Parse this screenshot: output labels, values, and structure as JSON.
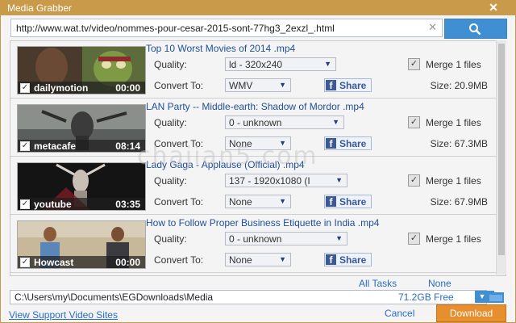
{
  "window": {
    "title": "Media Grabber"
  },
  "url_bar": {
    "value": "http://www.wat.tv/video/nommes-pour-cesar-2015-sont-77hg3_2exzl_.html"
  },
  "labels": {
    "quality": "Quality:",
    "convert_to": "Convert To:",
    "share": "Share",
    "merge": "Merge 1 files"
  },
  "items": [
    {
      "title": "Top 10 Worst Movies of 2014 .mp4",
      "source": "dailymotion",
      "duration": "00:00",
      "quality": "ld - 320x240",
      "convert": "WMV",
      "size": "Size: 20.9MB"
    },
    {
      "title": "LAN Party -- Middle-earth: Shadow of Mordor .mp4",
      "source": "metacafe",
      "duration": "08:14",
      "quality": "0 - unknown",
      "convert": "None",
      "size": "Size: 67.3MB"
    },
    {
      "title": "Lady Gaga - Applause (Official) .mp4",
      "source": "youtube",
      "duration": "03:35",
      "quality": "137 - 1920x1080 (I",
      "convert": "None",
      "size": "Size: 67.9MB"
    },
    {
      "title": "How to Follow Proper Business Etiquette in India .mp4",
      "source": "Howcast",
      "duration": "00:00",
      "quality": "0 - unknown",
      "convert": "None",
      "size": ""
    }
  ],
  "footer": {
    "all_tasks": "All Tasks",
    "none": "None",
    "path": "C:\\Users\\my\\Documents\\EGDownloads\\Media",
    "free_space": "71.2GB Free",
    "support_link": "View Support Video Sites",
    "cancel": "Cancel",
    "download": "Download"
  },
  "watermark": "chajian5.com",
  "colors": {
    "title_bar": "#c99a4a",
    "accent_blue": "#3f8fd2",
    "download": "#e78f2f",
    "link": "#2a6cc9",
    "video_title": "#1f4f99"
  }
}
